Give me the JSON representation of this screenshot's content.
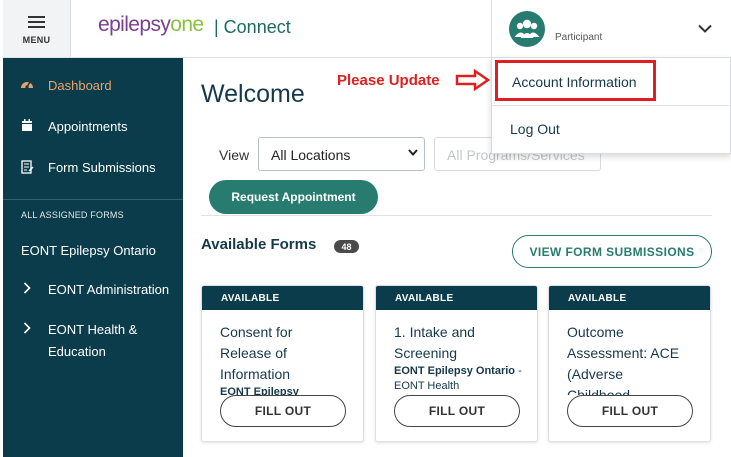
{
  "header": {
    "menu_label": "MENU",
    "logo_part1": "epilepsy",
    "logo_part2": "one",
    "app_name": "| Connect",
    "user_role": "Participant"
  },
  "dropdown": {
    "account_info": "Account Information",
    "logout": "Log Out"
  },
  "annotation": {
    "text": "Please Update",
    "color": "#e02020"
  },
  "sidebar": {
    "items": [
      {
        "label": "Dashboard",
        "icon": "dashboard-icon"
      },
      {
        "label": "Appointments",
        "icon": "calendar-icon"
      },
      {
        "label": "Form Submissions",
        "icon": "form-submissions-icon"
      }
    ],
    "section_title": "ALL ASSIGNED FORMS",
    "org_label": "EONT Epilepsy Ontario",
    "groups": [
      {
        "label": "EONT Administration",
        "icon": "chevron-right-icon"
      },
      {
        "label": "EONT Health &",
        "label2": "Education",
        "icon": "chevron-right-icon"
      }
    ]
  },
  "main": {
    "welcome": "Welcome",
    "view_label": "View",
    "location_select": "All Locations",
    "programs_select": "All Programs/Services",
    "request_button": "Request Appointment",
    "available_forms_title": "Available Forms",
    "available_forms_count": "48",
    "view_submissions_button": "VIEW FORM SUBMISSIONS"
  },
  "cards": [
    {
      "status": "AVAILABLE",
      "title_lines": [
        "Consent for",
        "Release of",
        "Information"
      ],
      "sub_bold": "EONT Epilepsy",
      "sub_rest": "",
      "button": "FILL OUT"
    },
    {
      "status": "AVAILABLE",
      "title_lines": [
        "1. Intake and",
        "Screening"
      ],
      "sub_bold": "EONT Epilepsy Ontario",
      "sub_rest": " - EONT Health",
      "button": "FILL OUT"
    },
    {
      "status": "AVAILABLE",
      "title_lines": [
        "Outcome",
        "Assessment: ACE",
        "(Adverse",
        "Childhood"
      ],
      "sub_bold": "",
      "sub_rest": "",
      "button": "FILL OUT"
    }
  ],
  "colors": {
    "sidebar_bg": "#0b3c4b",
    "accent_teal": "#277c6f",
    "active_item": "#e8a36b",
    "highlight_red": "#e02020"
  }
}
